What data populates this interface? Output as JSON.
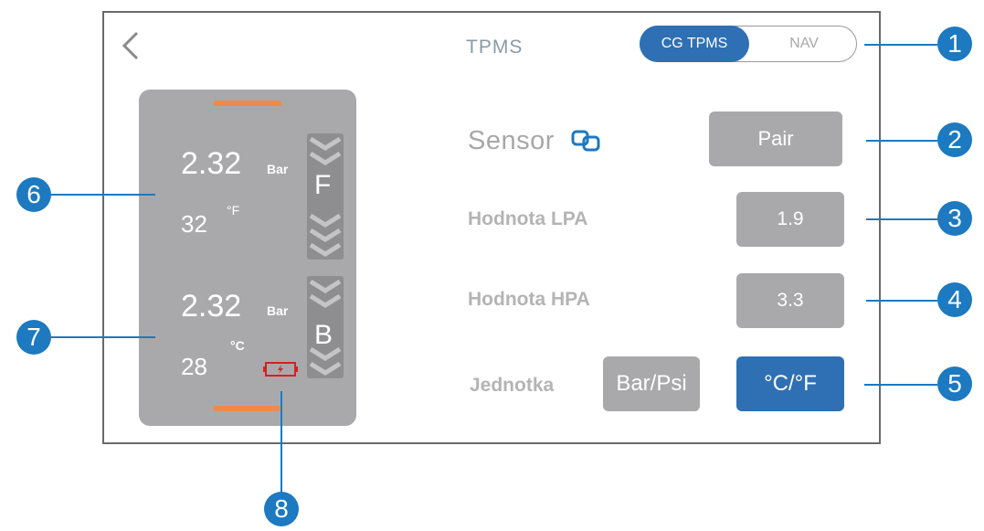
{
  "header": {
    "title": "TPMS",
    "toggle": {
      "active": "CG TPMS",
      "inactive": "NAV"
    }
  },
  "tires": {
    "front": {
      "pressure": "2.32",
      "pressure_unit": "Bar",
      "temperature": "32",
      "temperature_unit": "°F",
      "letter": "F"
    },
    "back": {
      "pressure": "2.32",
      "pressure_unit": "Bar",
      "temperature": "28",
      "temperature_unit": "°C",
      "letter": "B"
    }
  },
  "settings": {
    "sensor_label": "Sensor",
    "pair_label": "Pair",
    "lpa_label": "Hodnota LPA",
    "lpa_value": "1.9",
    "hpa_label": "Hodnota HPA",
    "hpa_value": "3.3",
    "unit_label": "Jednotka",
    "pressure_unit_btn": "Bar/Psi",
    "temp_unit_btn": "°C/°F"
  },
  "callouts": [
    "1",
    "2",
    "3",
    "4",
    "5",
    "6",
    "7",
    "8"
  ],
  "colors": {
    "accent": "#2f6fb4",
    "callout": "#1d79c0",
    "panel": "#a9a9ac",
    "indicator": "#f08a4b",
    "battery_warning": "#d62020"
  },
  "icons": [
    "back-chevron-icon",
    "sensor-link-icon",
    "battery-icon"
  ]
}
